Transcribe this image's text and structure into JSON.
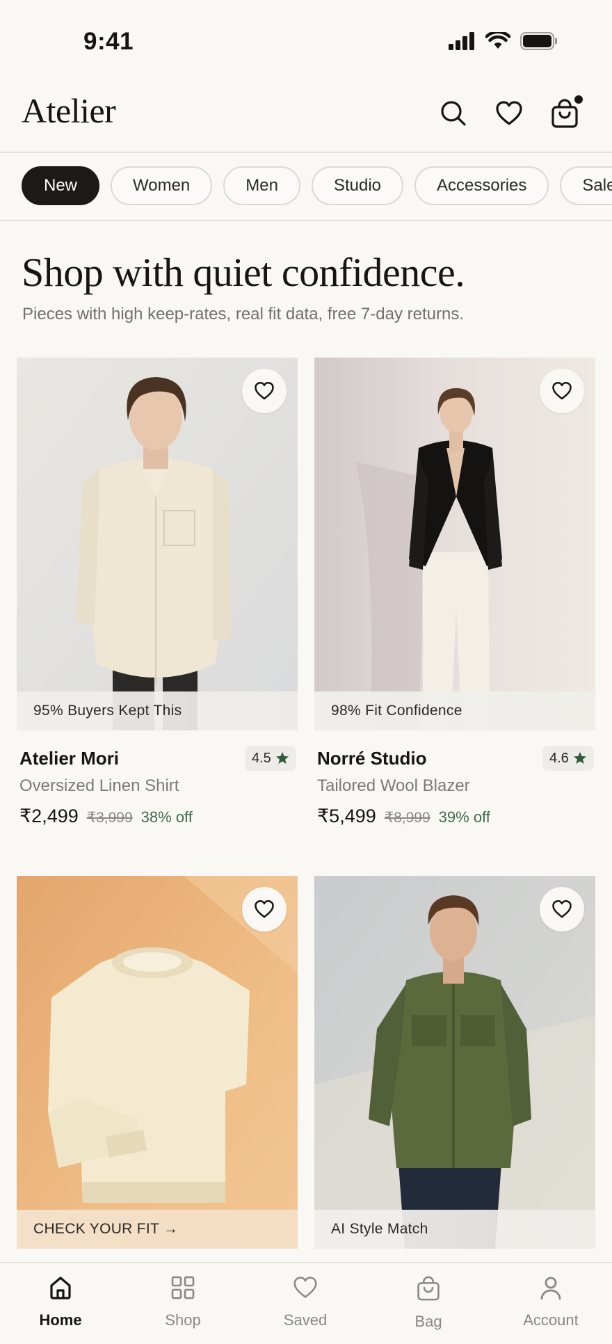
{
  "status": {
    "time": "9:41"
  },
  "header": {
    "brand": "Atelier"
  },
  "categories": [
    "New",
    "Women",
    "Men",
    "Studio",
    "Accessories",
    "Sale"
  ],
  "hero": {
    "title": "Shop with quiet confidence.",
    "subtitle": "Pieces with high keep-rates, real fit data, free 7-day returns."
  },
  "products": [
    {
      "badge": "95% Buyers Kept This",
      "brand": "Atelier Mori",
      "rating": "4.5",
      "name": "Oversized Linen Shirt",
      "price": "₹2,499",
      "original_price": "₹3,999",
      "discount": "38% off"
    },
    {
      "badge": "98% Fit Confidence",
      "brand": "Norré Studio",
      "rating": "4.6",
      "name": "Tailored Wool Blazer",
      "price": "₹5,499",
      "original_price": "₹8,999",
      "discount": "39% off"
    },
    {
      "badge": "CHECK YOUR FIT →"
    },
    {
      "badge": "AI Style Match"
    }
  ],
  "nav": [
    {
      "label": "Home",
      "icon": "home-icon"
    },
    {
      "label": "Shop",
      "icon": "grid-icon"
    },
    {
      "label": "Saved",
      "icon": "heart-icon"
    },
    {
      "label": "Bag",
      "icon": "bag-icon"
    },
    {
      "label": "Account",
      "icon": "user-icon"
    }
  ],
  "colors": {
    "accent_dark": "#1c1a17",
    "discount_green": "#3f6b4b",
    "star_green": "#2f5a3c",
    "background": "#f9f8f5"
  }
}
